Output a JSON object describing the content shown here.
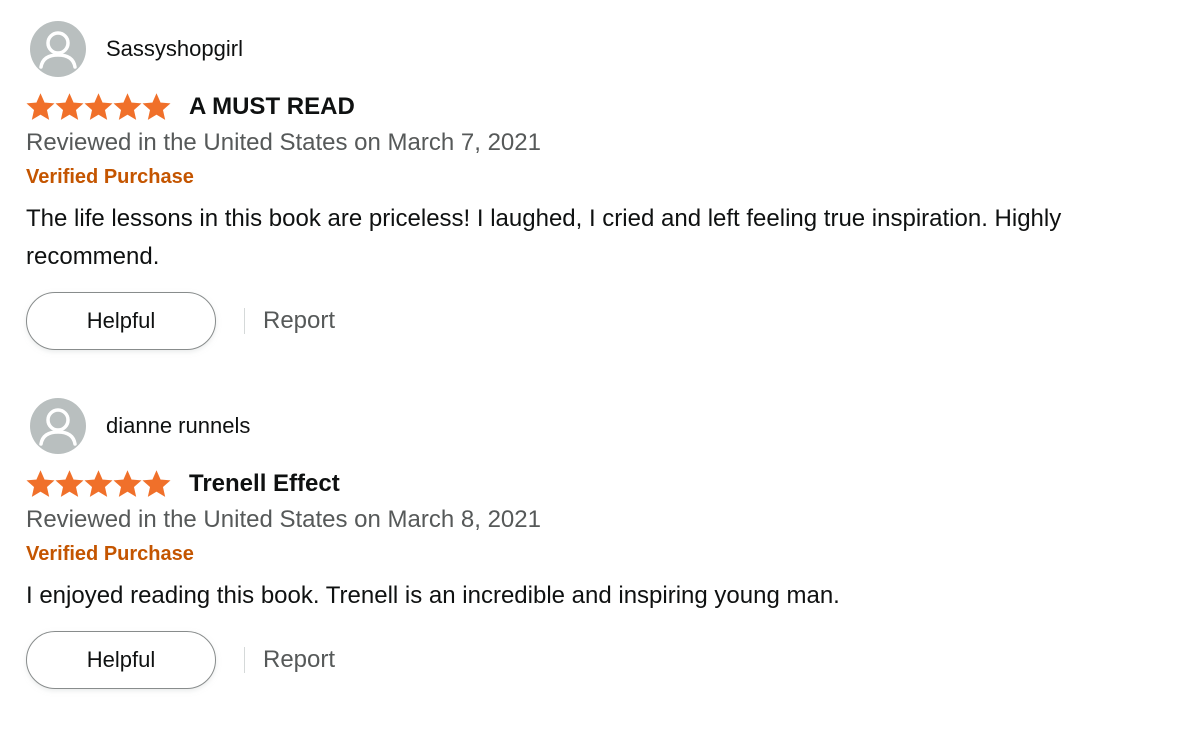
{
  "reviews": [
    {
      "profile_name": "Sassyshopgirl",
      "rating": 5,
      "title": "A MUST READ",
      "date": "Reviewed in the United States on March 7, 2021",
      "verified": "Verified Purchase",
      "body": "The life lessons in this book are priceless! I laughed, I cried and left feeling true inspiration. Highly recommend.",
      "helpful_label": "Helpful",
      "report_label": "Report"
    },
    {
      "profile_name": "dianne runnels",
      "rating": 5,
      "title": "Trenell Effect",
      "date": "Reviewed in the United States on March 8, 2021",
      "verified": "Verified Purchase",
      "body": "I enjoyed reading this book. Trenell is an incredible and inspiring young man.",
      "helpful_label": "Helpful",
      "report_label": "Report"
    }
  ],
  "colors": {
    "star": "#f0702a",
    "verified": "#c45500",
    "meta_text": "#565959",
    "avatar_bg": "#b9bfbf"
  },
  "icons": {
    "avatar": "user-silhouette-icon",
    "star": "star-filled-icon"
  }
}
